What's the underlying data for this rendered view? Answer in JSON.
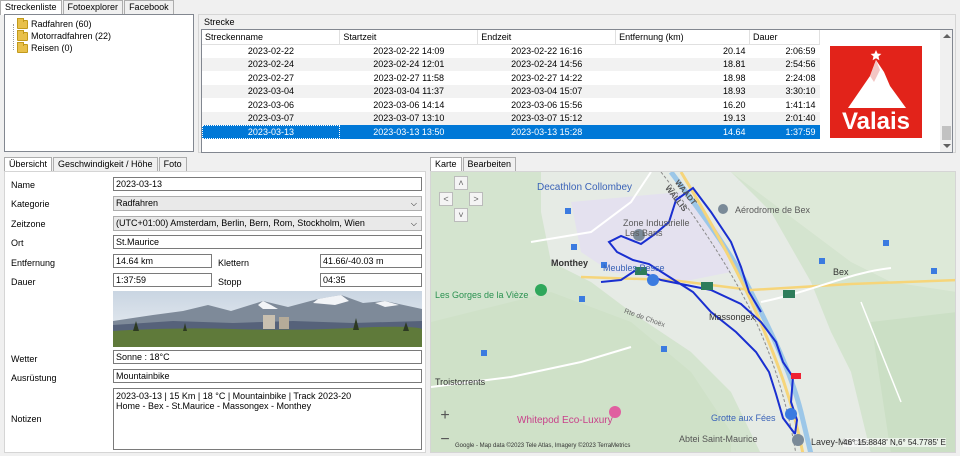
{
  "main_tabs": [
    "Streckenliste",
    "Fotoexplorer",
    "Facebook"
  ],
  "tree": [
    {
      "label": "Radfahren (60)"
    },
    {
      "label": "Motorradfahren (22)"
    },
    {
      "label": "Reisen (0)"
    }
  ],
  "strecke": {
    "title": "Strecke",
    "columns": [
      "Streckenname",
      "Startzeit",
      "Endzeit",
      "Entfernung (km)",
      "Dauer"
    ],
    "rows": [
      {
        "name": "2023-02-22",
        "start": "2023-02-22 14:09",
        "end": "2023-02-22 16:16",
        "dist": "20.14",
        "dur": "2:06:59"
      },
      {
        "name": "2023-02-24",
        "start": "2023-02-24 12:01",
        "end": "2023-02-24 14:56",
        "dist": "18.81",
        "dur": "2:54:56"
      },
      {
        "name": "2023-02-27",
        "start": "2023-02-27 11:58",
        "end": "2023-02-27 14:22",
        "dist": "18.98",
        "dur": "2:24:08"
      },
      {
        "name": "2023-03-04",
        "start": "2023-03-04 11:37",
        "end": "2023-03-04 15:07",
        "dist": "18.93",
        "dur": "3:30:10"
      },
      {
        "name": "2023-03-06",
        "start": "2023-03-06 14:14",
        "end": "2023-03-06 15:56",
        "dist": "16.20",
        "dur": "1:41:14"
      },
      {
        "name": "2023-03-07",
        "start": "2023-03-07 13:10",
        "end": "2023-03-07 15:12",
        "dist": "19.13",
        "dur": "2:01:40"
      },
      {
        "name": "2023-03-13",
        "start": "2023-03-13 13:50",
        "end": "2023-03-13 15:28",
        "dist": "14.64",
        "dur": "1:37:59"
      }
    ]
  },
  "logo": {
    "text": "Valais",
    "color": "#e2231a"
  },
  "detail_tabs": [
    "Übersicht",
    "Geschwindigkeit / Höhe",
    "Foto"
  ],
  "form": {
    "name_label": "Name",
    "name_value": "2023-03-13",
    "kategorie_label": "Kategorie",
    "kategorie_value": "Radfahren",
    "zeitzone_label": "Zeitzone",
    "zeitzone_value": "(UTC+01:00) Amsterdam, Berlin, Bern, Rom, Stockholm, Wien",
    "ort_label": "Ort",
    "ort_value": "St.Maurice",
    "entfernung_label": "Entfernung",
    "entfernung_value": "14.64 km",
    "klettern_label": "Klettern",
    "klettern_value": "41.66/-40.03 m",
    "dauer_label": "Dauer",
    "dauer_value": "1:37:59",
    "stopp_label": "Stopp",
    "stopp_value": "04:35",
    "wetter_label": "Wetter",
    "wetter_value": "Sonne  :  18°C",
    "ausruestung_label": "Ausrüstung",
    "ausruestung_value": "Mountainbike",
    "notizen_label": "Notizen",
    "notizen_line1": "2023-03-13  | 15 Km | 18 °C | Mountainbike  |  Track 2023-20",
    "notizen_line2": "Home - Bex - St.Maurice - Massongex - Monthey"
  },
  "map_tabs": [
    "Karte",
    "Bearbeiten"
  ],
  "map": {
    "places": {
      "decathlon": "Decathlon Collombey",
      "zone1": "Zone Industrielle",
      "zone2": "Les Bans",
      "aerodrome": "Aérodrome de Bex",
      "monthey": "Monthey",
      "meubles": "Meubles Pesse",
      "bex": "Bex",
      "gorges": "Les Gorges de la Vièze",
      "choex": "Rte de Choëx",
      "massongex": "Massongex",
      "troistorrents": "Troistorrents",
      "whitepod": "Whitepod Eco-Luxury",
      "grotte": "Grotte aux Fées",
      "abtei": "Abtei Saint-Maurice",
      "lavey": "Lavey-Morcles",
      "waadt": "WAADT",
      "wallis": "WALLIS"
    },
    "coords": "46° 15.8848' N,6° 54.7785' E",
    "attribution": "Google - Map data ©2023 Tele Atlas, Imagery ©2023 TerraMetrics",
    "zoom_in": "+",
    "zoom_out": "−",
    "route_color": "#1a2fd0"
  }
}
